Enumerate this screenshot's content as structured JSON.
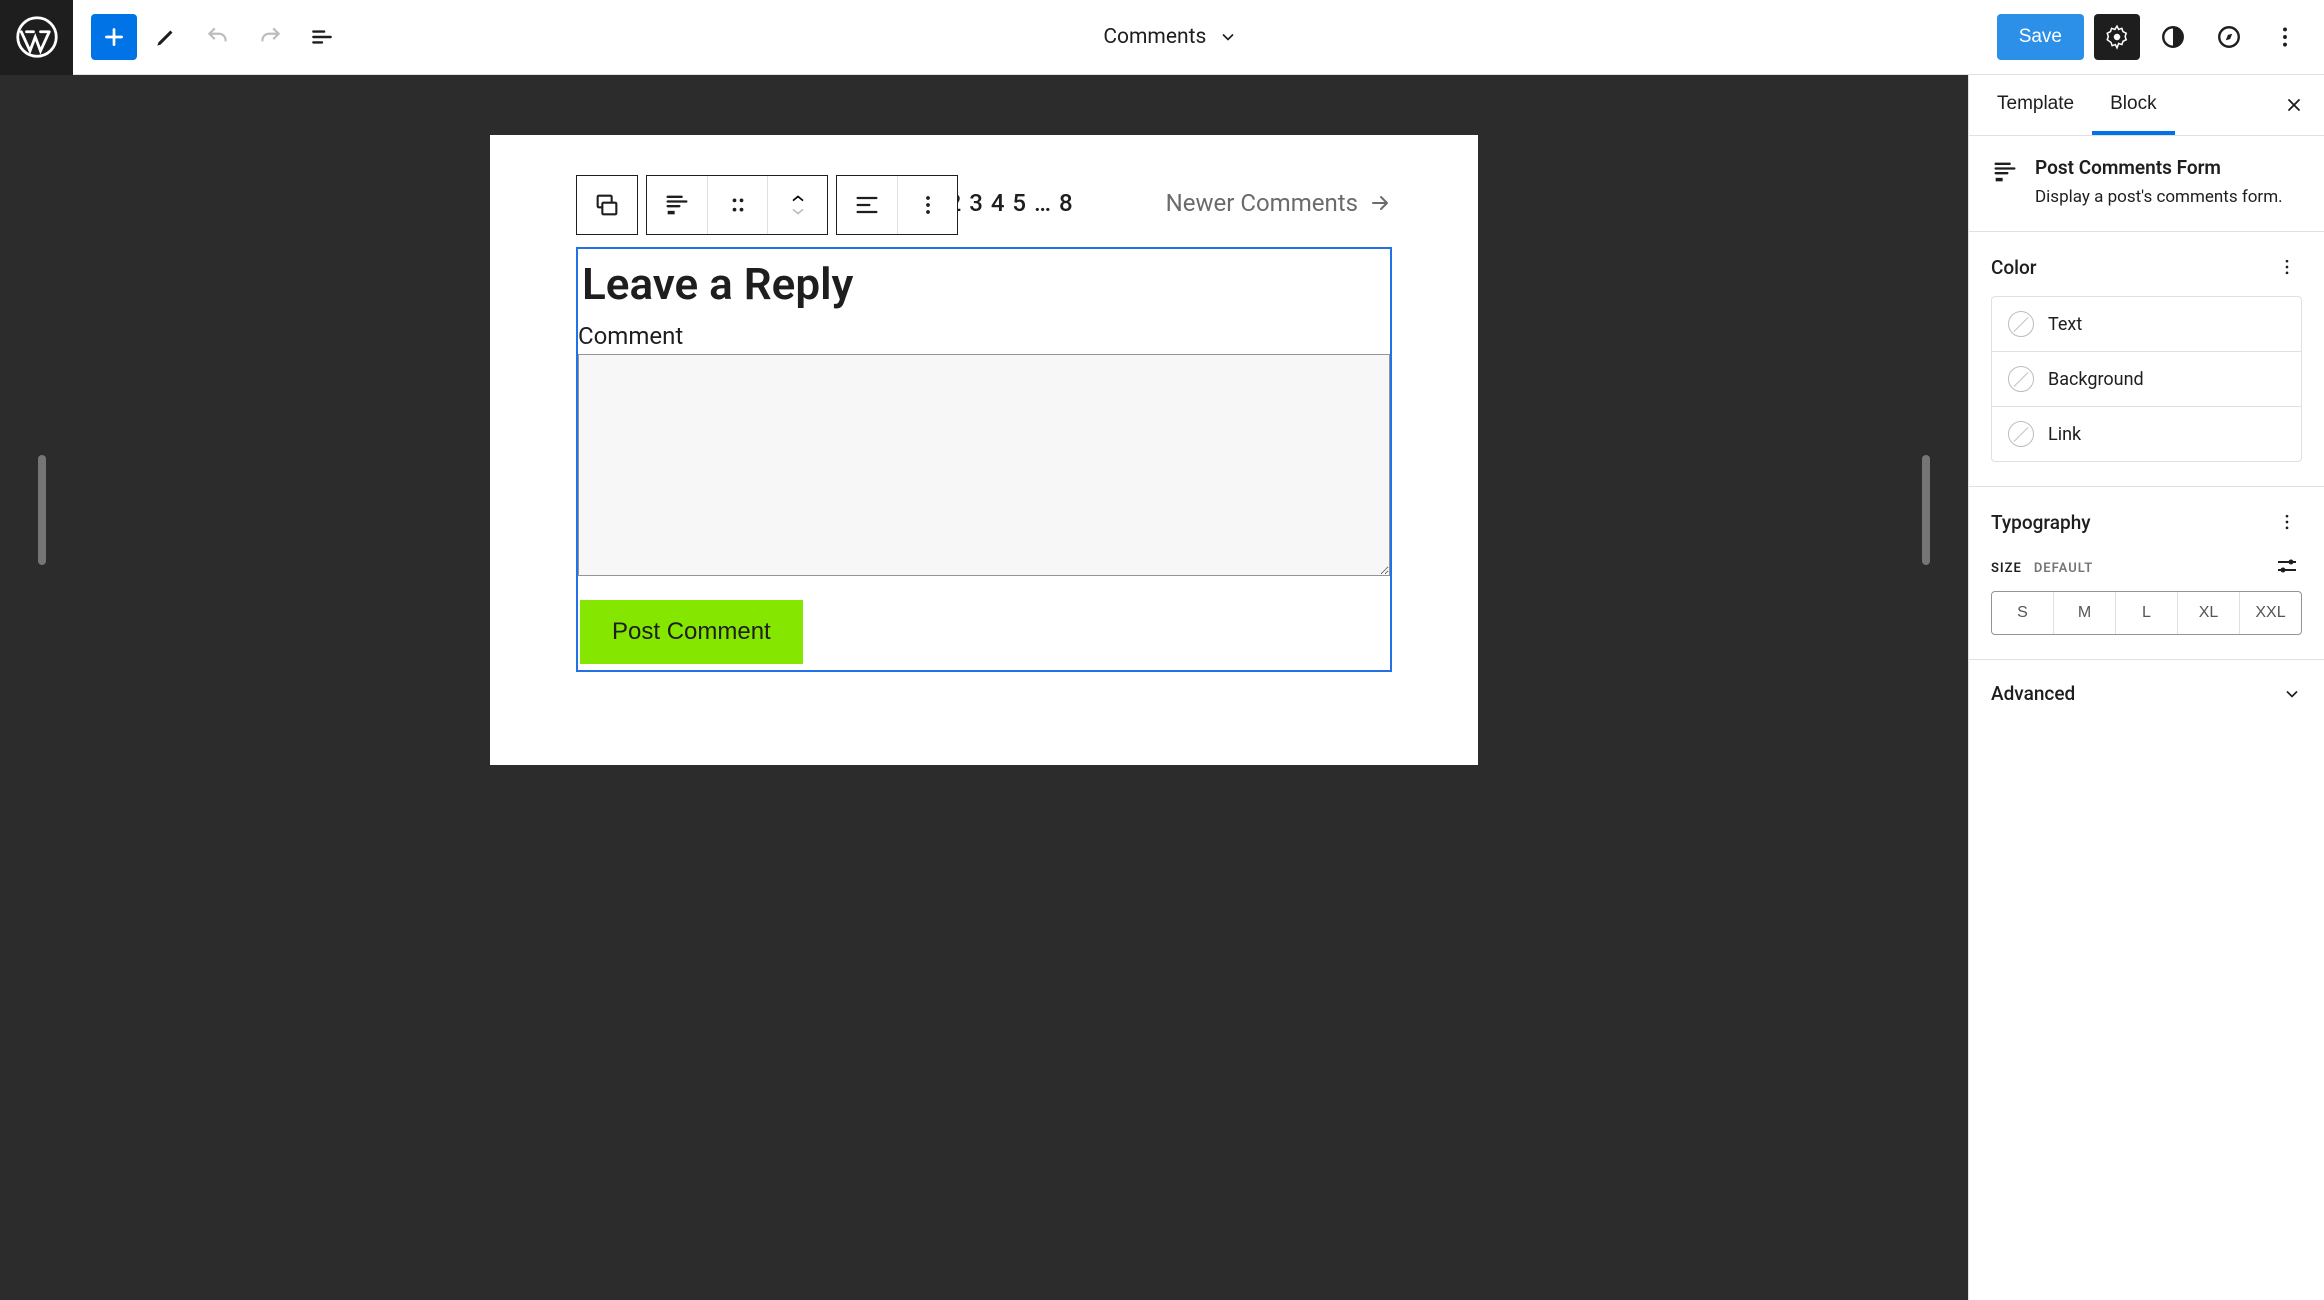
{
  "topbar": {
    "document_title": "Comments",
    "save_label": "Save"
  },
  "block_toolbar": {
    "group1_icon": "comments-block",
    "group2_icons": [
      "post-comments-form",
      "drag",
      "move-updown"
    ],
    "group3_icons": [
      "align-left",
      "more"
    ]
  },
  "canvas": {
    "pagination": {
      "numbers": "1 2 3 4 5 … 8",
      "newer_label": "Newer Comments"
    },
    "form": {
      "title": "Leave a Reply",
      "comment_label": "Comment",
      "textarea_value": "",
      "submit_label": "Post Comment"
    }
  },
  "sidebar": {
    "tabs": {
      "template": "Template",
      "block": "Block"
    },
    "block_info": {
      "title": "Post Comments Form",
      "description": "Display a post's comments form."
    },
    "color": {
      "title": "Color",
      "items": [
        "Text",
        "Background",
        "Link"
      ]
    },
    "typography": {
      "title": "Typography",
      "size_label": "SIZE",
      "size_default": "DEFAULT",
      "sizes": [
        "S",
        "M",
        "L",
        "XL",
        "XXL"
      ]
    },
    "advanced": {
      "title": "Advanced"
    }
  }
}
